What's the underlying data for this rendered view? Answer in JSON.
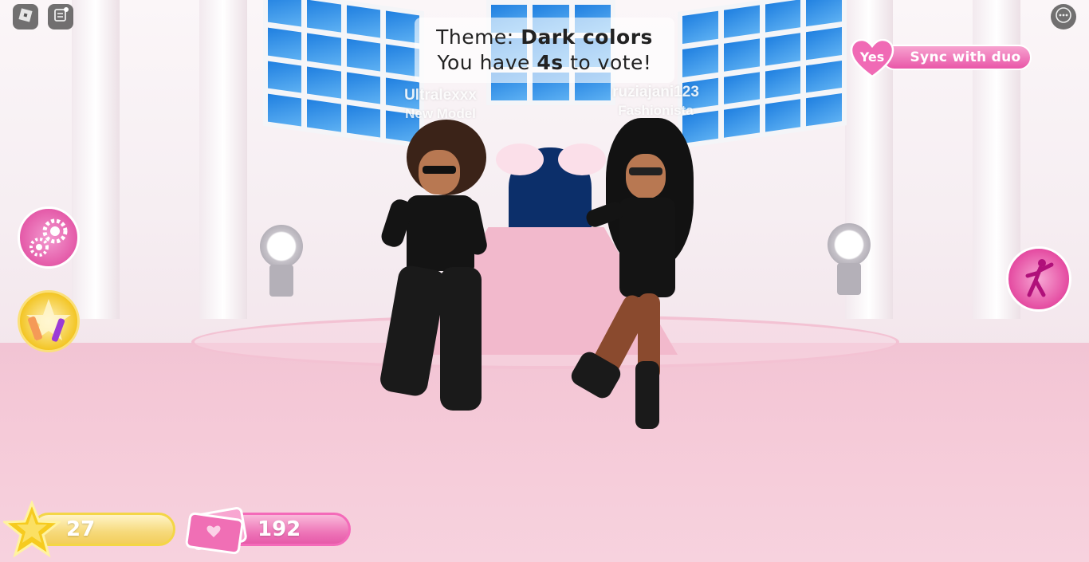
{
  "vote": {
    "theme_prefix": "Theme: ",
    "theme_value": "Dark colors",
    "timer_prefix": "You have ",
    "timer_value": "4s",
    "timer_suffix": " to vote!"
  },
  "players": [
    {
      "name": "Ultralexxx",
      "rank": "New Model"
    },
    {
      "name": "ruziajani123",
      "rank": "Fashionista"
    }
  ],
  "duo": {
    "yes_label": "Yes",
    "sync_label": "Sync with duo"
  },
  "stats": {
    "stars": "27",
    "money": "192"
  },
  "icons": {
    "roblox": "roblox-logo-icon",
    "chat": "chat-icon",
    "more": "more-options-icon",
    "settings": "settings-gears-icon",
    "makeup": "makeup-icon",
    "pose": "pose-icon",
    "star": "star-icon",
    "money": "money-icon",
    "heart": "heart-icon"
  },
  "colors": {
    "accent_pink": "#e956a8",
    "gold": "#f2c21a",
    "floor_pink": "#f5cad8"
  }
}
